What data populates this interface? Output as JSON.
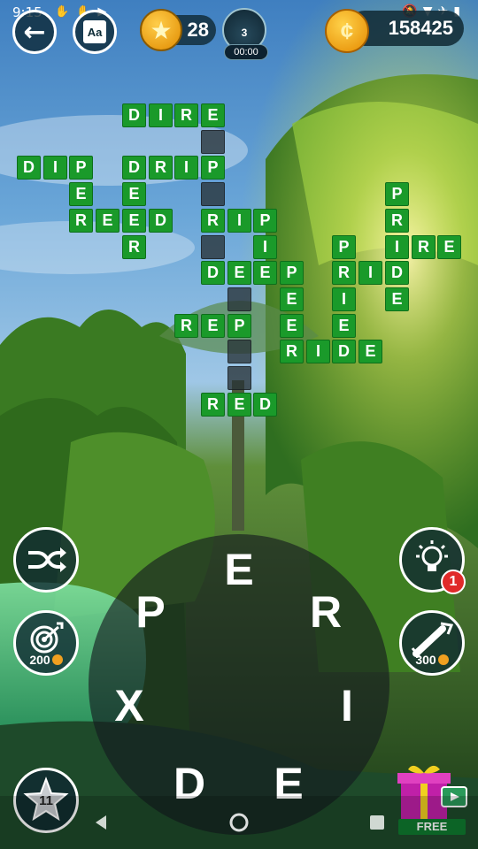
{
  "status_bar": {
    "time": "9:15"
  },
  "header": {
    "stars": "28",
    "level": "3",
    "timer": "00:00",
    "coins": "158425",
    "dict_label": "Aa"
  },
  "grid": {
    "tiles": [
      {
        "c": 4,
        "r": 0,
        "l": "D"
      },
      {
        "c": 5,
        "r": 0,
        "l": "I"
      },
      {
        "c": 6,
        "r": 0,
        "l": "R"
      },
      {
        "c": 7,
        "r": 0,
        "l": "E"
      },
      {
        "c": 7,
        "r": 1,
        "l": ""
      },
      {
        "c": 0,
        "r": 2,
        "l": "D"
      },
      {
        "c": 1,
        "r": 2,
        "l": "I"
      },
      {
        "c": 2,
        "r": 2,
        "l": "P"
      },
      {
        "c": 4,
        "r": 2,
        "l": "D"
      },
      {
        "c": 5,
        "r": 2,
        "l": "R"
      },
      {
        "c": 6,
        "r": 2,
        "l": "I"
      },
      {
        "c": 7,
        "r": 2,
        "l": "P"
      },
      {
        "c": 2,
        "r": 3,
        "l": "E"
      },
      {
        "c": 4,
        "r": 3,
        "l": "E"
      },
      {
        "c": 7,
        "r": 3,
        "l": ""
      },
      {
        "c": 14,
        "r": 3,
        "l": "P"
      },
      {
        "c": 2,
        "r": 4,
        "l": "R"
      },
      {
        "c": 3,
        "r": 4,
        "l": "E"
      },
      {
        "c": 4,
        "r": 4,
        "l": "E"
      },
      {
        "c": 5,
        "r": 4,
        "l": "D"
      },
      {
        "c": 7,
        "r": 4,
        "l": "R"
      },
      {
        "c": 8,
        "r": 4,
        "l": "I"
      },
      {
        "c": 9,
        "r": 4,
        "l": "P"
      },
      {
        "c": 14,
        "r": 4,
        "l": "R"
      },
      {
        "c": 4,
        "r": 5,
        "l": "R"
      },
      {
        "c": 7,
        "r": 5,
        "l": ""
      },
      {
        "c": 9,
        "r": 5,
        "l": "I"
      },
      {
        "c": 12,
        "r": 5,
        "l": "P"
      },
      {
        "c": 14,
        "r": 5,
        "l": "I"
      },
      {
        "c": 15,
        "r": 5,
        "l": "R"
      },
      {
        "c": 16,
        "r": 5,
        "l": "E"
      },
      {
        "c": 7,
        "r": 6,
        "l": "D"
      },
      {
        "c": 8,
        "r": 6,
        "l": "E"
      },
      {
        "c": 9,
        "r": 6,
        "l": "E"
      },
      {
        "c": 10,
        "r": 6,
        "l": "P"
      },
      {
        "c": 12,
        "r": 6,
        "l": "R"
      },
      {
        "c": 13,
        "r": 6,
        "l": "I"
      },
      {
        "c": 14,
        "r": 6,
        "l": "D"
      },
      {
        "c": 8,
        "r": 7,
        "l": ""
      },
      {
        "c": 10,
        "r": 7,
        "l": "E"
      },
      {
        "c": 12,
        "r": 7,
        "l": "I"
      },
      {
        "c": 14,
        "r": 7,
        "l": "E"
      },
      {
        "c": 6,
        "r": 8,
        "l": "R"
      },
      {
        "c": 7,
        "r": 8,
        "l": "E"
      },
      {
        "c": 8,
        "r": 8,
        "l": "P"
      },
      {
        "c": 10,
        "r": 8,
        "l": "E"
      },
      {
        "c": 12,
        "r": 8,
        "l": "E"
      },
      {
        "c": 8,
        "r": 9,
        "l": ""
      },
      {
        "c": 10,
        "r": 9,
        "l": "R"
      },
      {
        "c": 11,
        "r": 9,
        "l": "I"
      },
      {
        "c": 12,
        "r": 9,
        "l": "D"
      },
      {
        "c": 13,
        "r": 9,
        "l": "E"
      },
      {
        "c": 8,
        "r": 10,
        "l": ""
      },
      {
        "c": 7,
        "r": 11,
        "l": "R"
      },
      {
        "c": 8,
        "r": 11,
        "l": "E"
      },
      {
        "c": 9,
        "r": 11,
        "l": "D"
      }
    ]
  },
  "wheel": {
    "letters": [
      "E",
      "R",
      "I",
      "E",
      "D",
      "X",
      "P"
    ]
  },
  "buttons": {
    "target_cost": "200",
    "rocket_cost": "300",
    "hint_badge": "1",
    "star_count": "11",
    "free_label": "FREE"
  }
}
